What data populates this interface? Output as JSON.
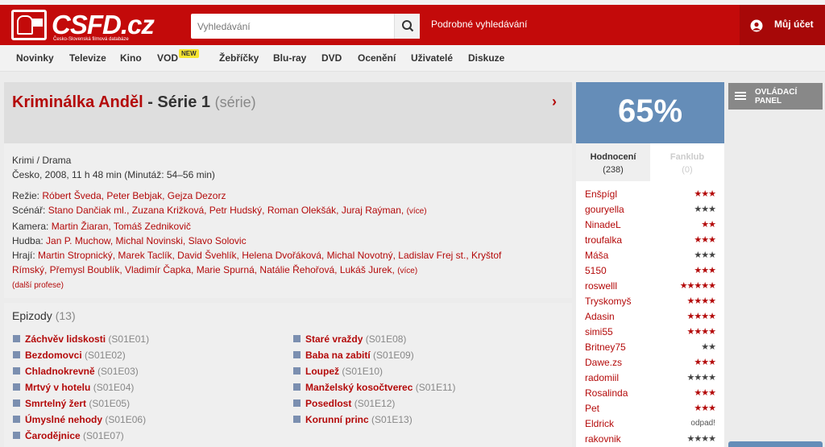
{
  "header": {
    "logo_text": "CSFD.cz",
    "logo_subtitle": "Česko-Slovenská filmová databáze",
    "search_placeholder": "Vyhledávání",
    "advanced_search": "Podrobné vyhledávání",
    "account": "Můj účet"
  },
  "nav": {
    "items": [
      "Novinky",
      "Televize",
      "Kino",
      "VOD",
      "Žebříčky",
      "Blu-ray",
      "DVD",
      "Ocenění",
      "Uživatelé",
      "Diskuze"
    ],
    "vod_badge": "NEW"
  },
  "film": {
    "title_main": "Kriminálka Anděl",
    "title_sep": " - ",
    "title_series": "Série 1",
    "title_type": "(série)",
    "genres": "Krimi / Drama",
    "origin": "Česko, 2008, 11 h 48 min (Minutáž: 54–56 min)",
    "directing_label": "Režie:",
    "directing": "Róbert Šveda, Peter Bebjak, Gejza Dezorz",
    "screenplay_label": "Scénář:",
    "screenplay": "Stano Dančiak ml., Zuzana Križková, Petr Hudský, Roman Olekšák, Juraj Raýman,",
    "screenplay_more": "(více)",
    "camera_label": "Kamera:",
    "camera": "Martin Žiaran, Tomáš Zednikovič",
    "music_label": "Hudba:",
    "music": "Jan P. Muchow, Michal Novinski, Slavo Solovic",
    "cast_label": "Hrají:",
    "cast_line1": "Martin Stropnický, Marek Taclík, David Švehlík, Helena Dvořáková, Michal Novotný, Ladislav Frej st., Kryštof",
    "cast_line2": "Rímský, Přemysl Boublík, Vladimír Čapka, Marie Spurná, Natálie Řehořová, Lukáš Jurek,",
    "cast_more": "(více)",
    "other_professions": "(další profese)"
  },
  "episodes": {
    "title": "Epizody",
    "count": "(13)",
    "left": [
      {
        "name": "Záchvěv lidskosti",
        "code": "(S01E01)"
      },
      {
        "name": "Bezdomovci",
        "code": "(S01E02)"
      },
      {
        "name": "Chladnokrevně",
        "code": "(S01E03)"
      },
      {
        "name": "Mrtvý v hotelu",
        "code": "(S01E04)"
      },
      {
        "name": "Smrtelný žert",
        "code": "(S01E05)"
      },
      {
        "name": "Úmyslné nehody",
        "code": "(S01E06)"
      },
      {
        "name": "Čarodějnice",
        "code": "(S01E07)"
      }
    ],
    "right": [
      {
        "name": "Staré vraždy",
        "code": "(S01E08)"
      },
      {
        "name": "Baba na zabití",
        "code": "(S01E09)"
      },
      {
        "name": "Loupež",
        "code": "(S01E10)"
      },
      {
        "name": "Manželský kosočtverec",
        "code": "(S01E11)"
      },
      {
        "name": "Posedlost",
        "code": "(S01E12)"
      },
      {
        "name": "Korunní princ",
        "code": "(S01E13)"
      }
    ]
  },
  "rating": {
    "score": "65%",
    "tab_ratings": "Hodnocení",
    "tab_ratings_count": "(238)",
    "tab_fanclub": "Fanklub",
    "tab_fanclub_count": "(0)",
    "users": [
      {
        "name": "Enšpígl",
        "stars": "★★★",
        "color": "#b40a0a"
      },
      {
        "name": "gouryella",
        "stars": "★★★",
        "color": "#444444"
      },
      {
        "name": "NinadeL",
        "stars": "★★",
        "color": "#b40a0a"
      },
      {
        "name": "troufalka",
        "stars": "★★★",
        "color": "#b40a0a"
      },
      {
        "name": "Máša",
        "stars": "★★★",
        "color": "#444444"
      },
      {
        "name": "5150",
        "stars": "★★★",
        "color": "#b40a0a"
      },
      {
        "name": "roswelll",
        "stars": "★★★★★",
        "color": "#b40a0a"
      },
      {
        "name": "Tryskomyš",
        "stars": "★★★★",
        "color": "#b40a0a"
      },
      {
        "name": "Adasin",
        "stars": "★★★★",
        "color": "#b40a0a"
      },
      {
        "name": "simi55",
        "stars": "★★★★",
        "color": "#b40a0a"
      },
      {
        "name": "Britney75",
        "stars": "★★",
        "color": "#444444"
      },
      {
        "name": "Dawe.zs",
        "stars": "★★★",
        "color": "#b40a0a"
      },
      {
        "name": "radomiil",
        "stars": "★★★★",
        "color": "#444444"
      },
      {
        "name": "Rosalinda",
        "stars": "★★★",
        "color": "#b40a0a"
      },
      {
        "name": "Pet",
        "stars": "★★★",
        "color": "#b40a0a"
      },
      {
        "name": "Eldrick",
        "stars": "odpad!",
        "color": "#555555"
      },
      {
        "name": "rakovnik",
        "stars": "★★★★",
        "color": "#444444"
      }
    ]
  },
  "control_panel": "OVLÁDACÍ PANEL",
  "colors": {
    "brand_red": "#c30a0a",
    "link_red": "#b40a0a",
    "score_blue": "#658db8"
  }
}
